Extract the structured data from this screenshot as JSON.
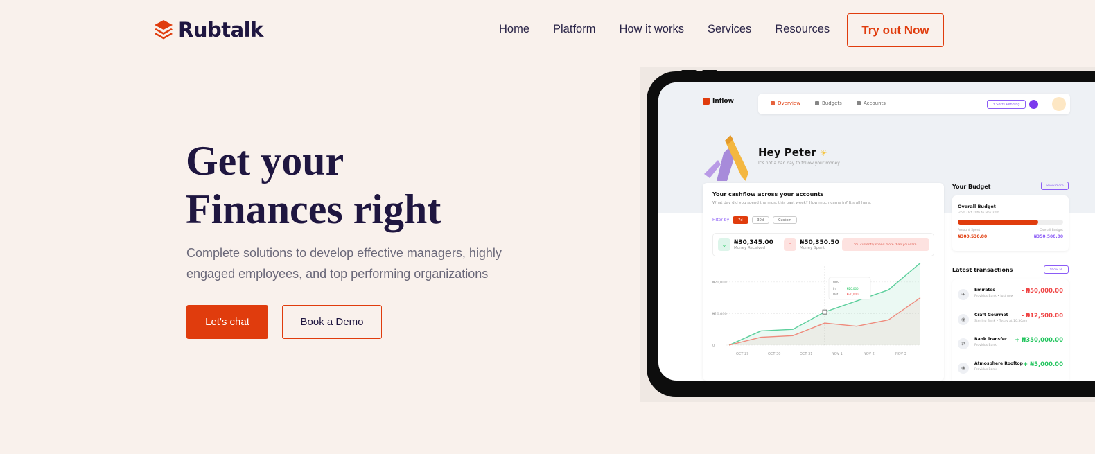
{
  "brand": {
    "name": "Rubtalk",
    "accent": "#e03c0d",
    "text": "#1f1640"
  },
  "nav": {
    "items": [
      "Home",
      "Platform",
      "How it works",
      "Services",
      "Resources"
    ],
    "cta": "Try out Now"
  },
  "hero": {
    "title_line1": "Get your",
    "title_line2": "Finances right",
    "subtitle": "Complete solutions to develop effective managers, highly engaged employees, and top performing organizations",
    "primary_button": "Let's chat",
    "secondary_button": "Book a Demo"
  },
  "mockup": {
    "app_name": "Inflow",
    "tabs": [
      "Overview",
      "Budgets",
      "Accounts"
    ],
    "pending_badge": "3 Sorts Pending",
    "greeting": "Hey Peter",
    "greeting_sub": "It's not a bad day to follow your money.",
    "cashflow": {
      "title": "Your cashflow across your accounts",
      "subtitle": "What day did you spend the most this past week? How much came in? It's all here.",
      "filter_label": "Filter by",
      "filters": [
        "7d",
        "30d",
        "Custom"
      ],
      "received_value": "₦30,345.00",
      "received_label": "Money Received",
      "spent_value": "₦50,350.50",
      "spent_label": "Money Spent",
      "warning": "You currently spend more than you earn."
    },
    "chart_data": {
      "type": "line",
      "categories": [
        "OCT 29",
        "OCT 30",
        "OCT 31",
        "NOV 1",
        "NOV 2",
        "NOV 3",
        "NOV 4"
      ],
      "y_ticks": [
        "₦20,000",
        "₦10,000",
        "0"
      ],
      "ylim": [
        0,
        25000
      ],
      "series": [
        {
          "color": "#5ccf9c",
          "values": [
            0,
            4500,
            5000,
            10500,
            14000,
            17500,
            26000
          ]
        },
        {
          "color": "#ef8a7c",
          "values": [
            0,
            2500,
            3000,
            7000,
            6000,
            8000,
            15000
          ]
        }
      ],
      "tooltip": {
        "date": "NOV 1",
        "in_label": "In",
        "in_value": "₦20,000",
        "out_label": "Out",
        "out_value": "₦20,000"
      }
    },
    "budget": {
      "title": "Your Budget",
      "show_more": "Show more",
      "card_title": "Overall Budget",
      "card_sub": "From Oct 20th to Nov 20th",
      "progress": 0.76,
      "spent_label": "Amount Spent",
      "spent_value": "₦300,530.80",
      "overall_label": "Overall Budget",
      "overall_value": "₦350,500.00"
    },
    "transactions": {
      "title": "Latest transactions",
      "show_all": "Show all",
      "items": [
        {
          "name": "Emirates",
          "meta": "Providus Bank • Just now",
          "amount": "- ₦50,000.00",
          "sign": "neg",
          "icon": "plane-icon"
        },
        {
          "name": "Craft Gourmet",
          "meta": "Sterling Bank • Today at 10:30am",
          "amount": "- ₦12,500.00",
          "sign": "neg",
          "icon": "food-icon"
        },
        {
          "name": "Bank Transfer",
          "meta": "Providus Bank",
          "amount": "+ ₦350,000.00",
          "sign": "pos",
          "icon": "transfer-icon"
        },
        {
          "name": "Atmosphere Rooftop",
          "meta": "Providus Bank",
          "amount": "+ ₦5,000.00",
          "sign": "pos",
          "icon": "food-icon"
        }
      ]
    }
  }
}
